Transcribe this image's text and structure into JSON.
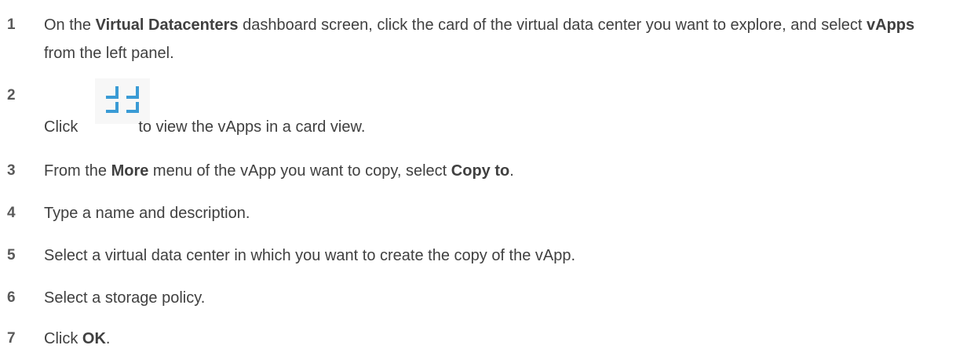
{
  "steps": [
    {
      "number": "1",
      "p1": "On the ",
      "b1": "Virtual Datacenters",
      "p2": " dashboard screen, click the card of the virtual data center you want to explore, and select ",
      "b2": "vApps",
      "p3": " from the left panel."
    },
    {
      "number": "2",
      "p1": "Click",
      "icon": "card-view-icon",
      "p2": "to view the vApps in a card view."
    },
    {
      "number": "3",
      "p1": "From the ",
      "b1": "More",
      "p2": " menu of the vApp you want to copy, select ",
      "b2": "Copy to",
      "p3": "."
    },
    {
      "number": "4",
      "p1": "Type a name and description."
    },
    {
      "number": "5",
      "p1": "Select a virtual data center in which you want to create the copy of the vApp."
    },
    {
      "number": "6",
      "p1": "Select a storage policy."
    },
    {
      "number": "7",
      "p1": "Click ",
      "b1": "OK",
      "p2": "."
    }
  ],
  "colors": {
    "text": "#404040",
    "number": "#595959",
    "icon": "#3a9bd5"
  }
}
